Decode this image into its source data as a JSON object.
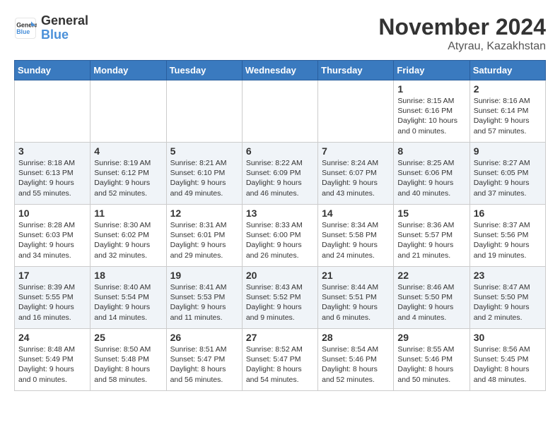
{
  "header": {
    "logo_line1": "General",
    "logo_line2": "Blue",
    "month": "November 2024",
    "location": "Atyrau, Kazakhstan"
  },
  "weekdays": [
    "Sunday",
    "Monday",
    "Tuesday",
    "Wednesday",
    "Thursday",
    "Friday",
    "Saturday"
  ],
  "weeks": [
    [
      {
        "day": "",
        "detail": ""
      },
      {
        "day": "",
        "detail": ""
      },
      {
        "day": "",
        "detail": ""
      },
      {
        "day": "",
        "detail": ""
      },
      {
        "day": "",
        "detail": ""
      },
      {
        "day": "1",
        "detail": "Sunrise: 8:15 AM\nSunset: 6:16 PM\nDaylight: 10 hours\nand 0 minutes."
      },
      {
        "day": "2",
        "detail": "Sunrise: 8:16 AM\nSunset: 6:14 PM\nDaylight: 9 hours\nand 57 minutes."
      }
    ],
    [
      {
        "day": "3",
        "detail": "Sunrise: 8:18 AM\nSunset: 6:13 PM\nDaylight: 9 hours\nand 55 minutes."
      },
      {
        "day": "4",
        "detail": "Sunrise: 8:19 AM\nSunset: 6:12 PM\nDaylight: 9 hours\nand 52 minutes."
      },
      {
        "day": "5",
        "detail": "Sunrise: 8:21 AM\nSunset: 6:10 PM\nDaylight: 9 hours\nand 49 minutes."
      },
      {
        "day": "6",
        "detail": "Sunrise: 8:22 AM\nSunset: 6:09 PM\nDaylight: 9 hours\nand 46 minutes."
      },
      {
        "day": "7",
        "detail": "Sunrise: 8:24 AM\nSunset: 6:07 PM\nDaylight: 9 hours\nand 43 minutes."
      },
      {
        "day": "8",
        "detail": "Sunrise: 8:25 AM\nSunset: 6:06 PM\nDaylight: 9 hours\nand 40 minutes."
      },
      {
        "day": "9",
        "detail": "Sunrise: 8:27 AM\nSunset: 6:05 PM\nDaylight: 9 hours\nand 37 minutes."
      }
    ],
    [
      {
        "day": "10",
        "detail": "Sunrise: 8:28 AM\nSunset: 6:03 PM\nDaylight: 9 hours\nand 34 minutes."
      },
      {
        "day": "11",
        "detail": "Sunrise: 8:30 AM\nSunset: 6:02 PM\nDaylight: 9 hours\nand 32 minutes."
      },
      {
        "day": "12",
        "detail": "Sunrise: 8:31 AM\nSunset: 6:01 PM\nDaylight: 9 hours\nand 29 minutes."
      },
      {
        "day": "13",
        "detail": "Sunrise: 8:33 AM\nSunset: 6:00 PM\nDaylight: 9 hours\nand 26 minutes."
      },
      {
        "day": "14",
        "detail": "Sunrise: 8:34 AM\nSunset: 5:58 PM\nDaylight: 9 hours\nand 24 minutes."
      },
      {
        "day": "15",
        "detail": "Sunrise: 8:36 AM\nSunset: 5:57 PM\nDaylight: 9 hours\nand 21 minutes."
      },
      {
        "day": "16",
        "detail": "Sunrise: 8:37 AM\nSunset: 5:56 PM\nDaylight: 9 hours\nand 19 minutes."
      }
    ],
    [
      {
        "day": "17",
        "detail": "Sunrise: 8:39 AM\nSunset: 5:55 PM\nDaylight: 9 hours\nand 16 minutes."
      },
      {
        "day": "18",
        "detail": "Sunrise: 8:40 AM\nSunset: 5:54 PM\nDaylight: 9 hours\nand 14 minutes."
      },
      {
        "day": "19",
        "detail": "Sunrise: 8:41 AM\nSunset: 5:53 PM\nDaylight: 9 hours\nand 11 minutes."
      },
      {
        "day": "20",
        "detail": "Sunrise: 8:43 AM\nSunset: 5:52 PM\nDaylight: 9 hours\nand 9 minutes."
      },
      {
        "day": "21",
        "detail": "Sunrise: 8:44 AM\nSunset: 5:51 PM\nDaylight: 9 hours\nand 6 minutes."
      },
      {
        "day": "22",
        "detail": "Sunrise: 8:46 AM\nSunset: 5:50 PM\nDaylight: 9 hours\nand 4 minutes."
      },
      {
        "day": "23",
        "detail": "Sunrise: 8:47 AM\nSunset: 5:50 PM\nDaylight: 9 hours\nand 2 minutes."
      }
    ],
    [
      {
        "day": "24",
        "detail": "Sunrise: 8:48 AM\nSunset: 5:49 PM\nDaylight: 9 hours\nand 0 minutes."
      },
      {
        "day": "25",
        "detail": "Sunrise: 8:50 AM\nSunset: 5:48 PM\nDaylight: 8 hours\nand 58 minutes."
      },
      {
        "day": "26",
        "detail": "Sunrise: 8:51 AM\nSunset: 5:47 PM\nDaylight: 8 hours\nand 56 minutes."
      },
      {
        "day": "27",
        "detail": "Sunrise: 8:52 AM\nSunset: 5:47 PM\nDaylight: 8 hours\nand 54 minutes."
      },
      {
        "day": "28",
        "detail": "Sunrise: 8:54 AM\nSunset: 5:46 PM\nDaylight: 8 hours\nand 52 minutes."
      },
      {
        "day": "29",
        "detail": "Sunrise: 8:55 AM\nSunset: 5:46 PM\nDaylight: 8 hours\nand 50 minutes."
      },
      {
        "day": "30",
        "detail": "Sunrise: 8:56 AM\nSunset: 5:45 PM\nDaylight: 8 hours\nand 48 minutes."
      }
    ]
  ]
}
